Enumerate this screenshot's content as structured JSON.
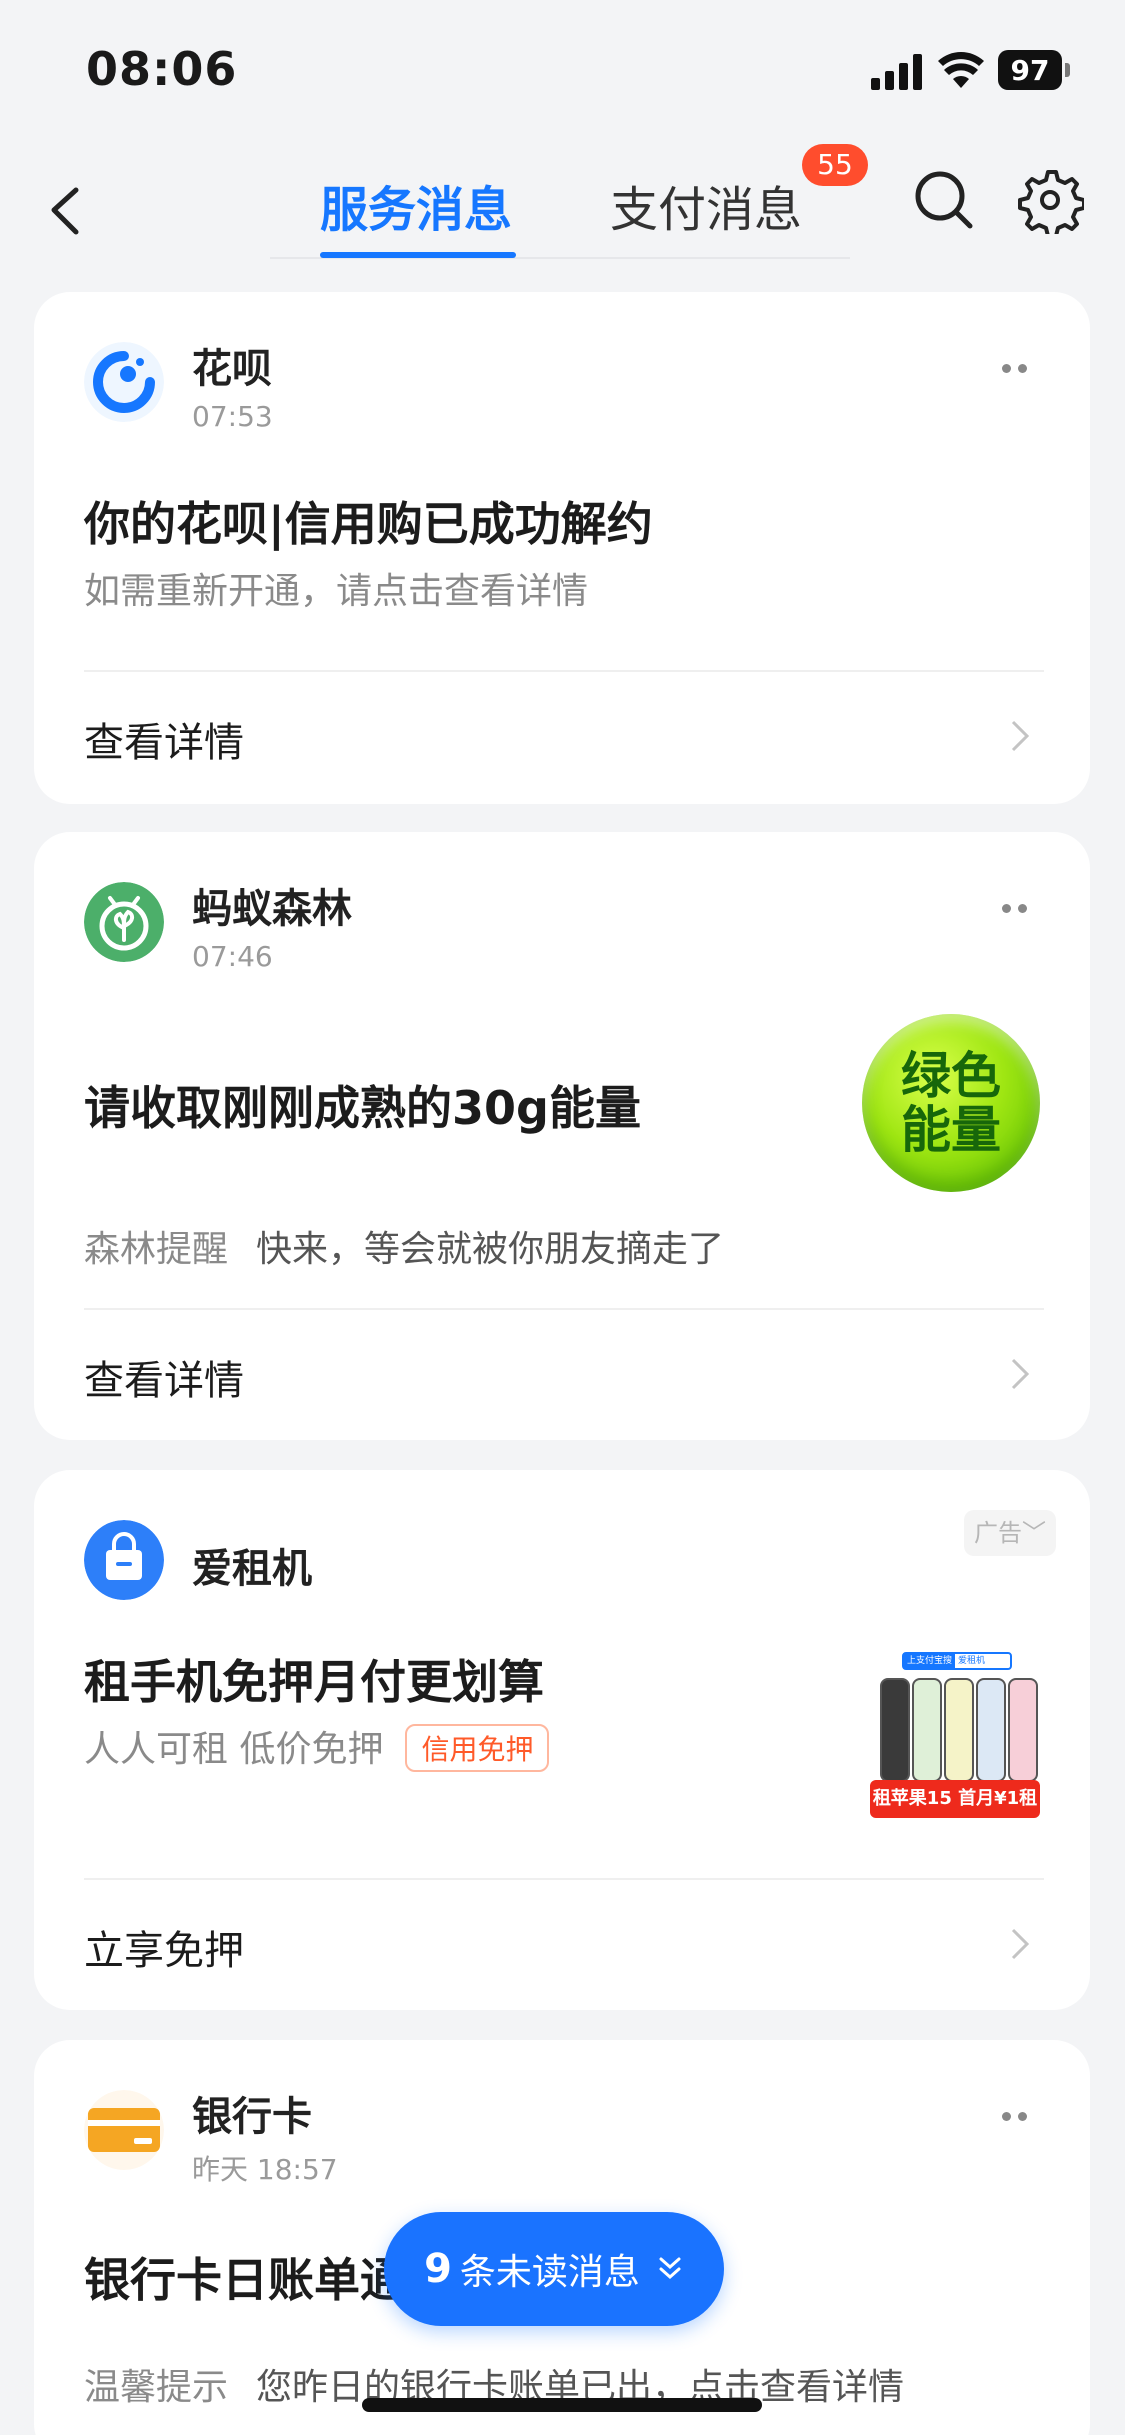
{
  "status_bar": {
    "time": "08:06",
    "battery": "97"
  },
  "nav": {
    "tabs": [
      {
        "label": "服务消息",
        "active": true
      },
      {
        "label": "支付消息",
        "active": false
      }
    ],
    "pay_badge": "55"
  },
  "cards": [
    {
      "app": "花呗",
      "time": "07:53",
      "title": "你的花呗|信用购已成功解约",
      "subtitle": "如需重新开通，请点击查看详情",
      "action": "查看详情"
    },
    {
      "app": "蚂蚁森林",
      "time": "07:46",
      "title": "请收取刚刚成熟的30g能量",
      "sub_label": "森林提醒",
      "sub_text": "快来，等会就被你朋友摘走了",
      "badge_line1": "绿色",
      "badge_line2": "能量",
      "action": "查看详情"
    },
    {
      "app": "爱租机",
      "ad_label": "广告",
      "title": "租手机免押月付更划算",
      "subtitle": "人人可租 低价免押",
      "tag": "信用免押",
      "ad_image": {
        "top_a": "上支付宝搜",
        "top_b": "爱租机",
        "offer": "租苹果15 首月¥1租"
      },
      "action": "立享免押"
    },
    {
      "app": "银行卡",
      "time": "昨天 18:57",
      "title": "银行卡日账单通知",
      "sub_label": "温馨提示",
      "sub_text": "您昨日的银行卡账单已出，点击查看详情"
    }
  ],
  "unread": {
    "count": "9",
    "label": "条未读消息"
  },
  "colors": {
    "accent": "#1677ff",
    "badge": "#ff4d2d",
    "forest": "#4caf6a",
    "bank": "#f5a623"
  }
}
